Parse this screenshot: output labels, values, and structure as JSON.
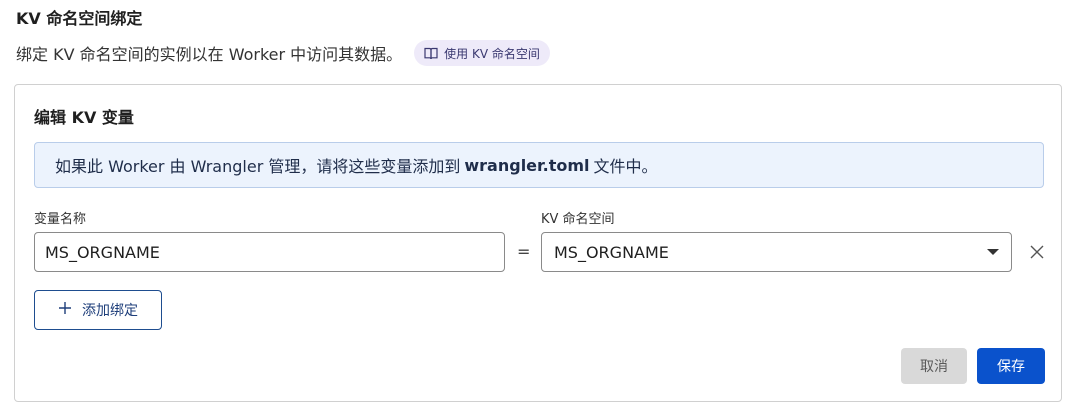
{
  "section": {
    "title": "KV 命名空间绑定",
    "description": "绑定 KV 命名空间的实例以在 Worker 中访问其数据。",
    "doc_link_label": "使用 KV 命名空间",
    "doc_link_icon": "book-icon"
  },
  "card": {
    "title": "编辑 KV 变量",
    "banner": {
      "prefix": "如果此 Worker 由 Wrangler 管理，请将这些变量添加到",
      "filename": "wrangler.toml",
      "suffix": "文件中。"
    },
    "variable_name_label": "变量名称",
    "namespace_label": "KV 命名空间",
    "equals": "=",
    "variable_name_value": "MS_ORGNAME",
    "namespace_value": "MS_ORGNAME",
    "add_binding_label": "添加绑定",
    "cancel_label": "取消",
    "save_label": "保存"
  },
  "colors": {
    "primary": "#0a52cc",
    "banner_bg": "#ecf3fd",
    "pill_bg": "#eeeaf9"
  }
}
